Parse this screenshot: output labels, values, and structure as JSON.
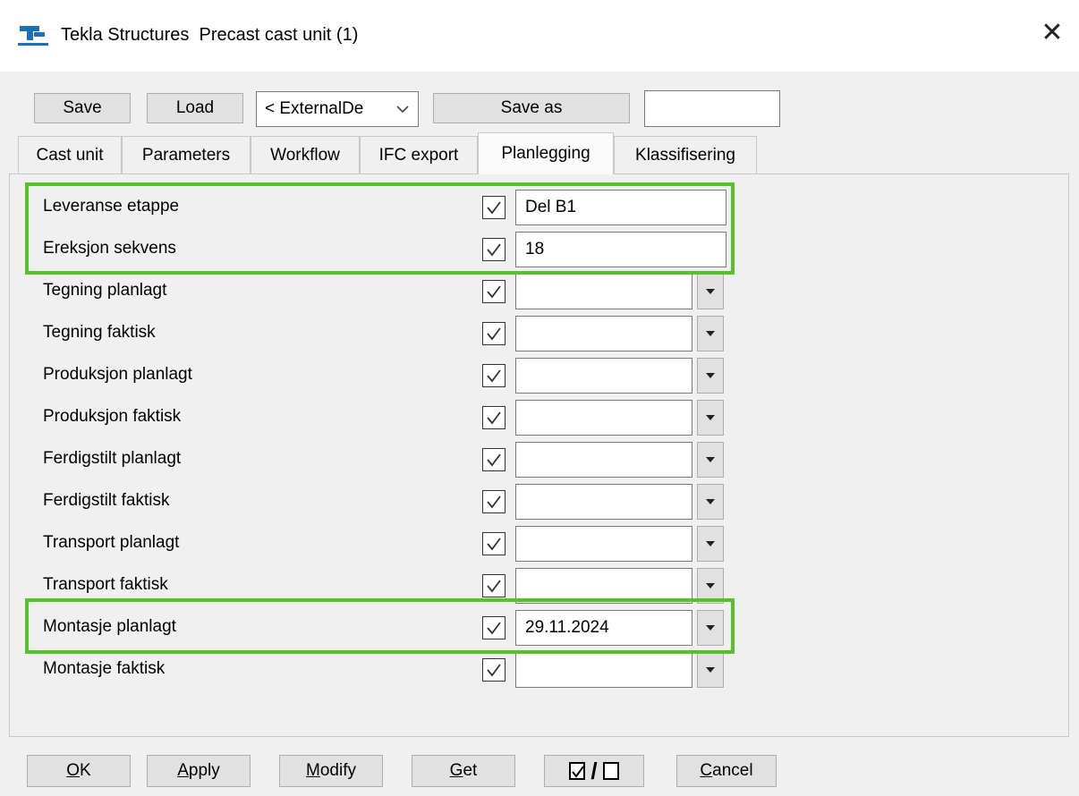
{
  "window": {
    "app_name": "Tekla Structures",
    "dialog_title": "Precast cast unit (1)",
    "close_glyph": "✕"
  },
  "toolbar": {
    "save_label": "Save",
    "load_label": "Load",
    "preset_value": "< ExternalDe",
    "save_as_label": "Save as",
    "save_as_name": ""
  },
  "tabs": [
    {
      "label": "Cast unit"
    },
    {
      "label": "Parameters"
    },
    {
      "label": "Workflow"
    },
    {
      "label": "IFC export"
    },
    {
      "label": "Planlegging",
      "active": true
    },
    {
      "label": "Klassifisering"
    }
  ],
  "rows": [
    {
      "label": "Leveranse etappe",
      "value": "Del B1",
      "checked": true,
      "has_dropdown": false
    },
    {
      "label": "Ereksjon sekvens",
      "value": "18",
      "checked": true,
      "has_dropdown": false
    },
    {
      "label": "Tegning planlagt",
      "value": "",
      "checked": true,
      "has_dropdown": true
    },
    {
      "label": "Tegning faktisk",
      "value": "",
      "checked": true,
      "has_dropdown": true
    },
    {
      "label": "Produksjon planlagt",
      "value": "",
      "checked": true,
      "has_dropdown": true
    },
    {
      "label": "Produksjon faktisk",
      "value": "",
      "checked": true,
      "has_dropdown": true
    },
    {
      "label": "Ferdigstilt planlagt",
      "value": "",
      "checked": true,
      "has_dropdown": true
    },
    {
      "label": "Ferdigstilt faktisk",
      "value": "",
      "checked": true,
      "has_dropdown": true
    },
    {
      "label": "Transport planlagt",
      "value": "",
      "checked": true,
      "has_dropdown": true
    },
    {
      "label": "Transport faktisk",
      "value": "",
      "checked": true,
      "has_dropdown": true
    },
    {
      "label": "Montasje planlagt",
      "value": "29.11.2024",
      "checked": true,
      "has_dropdown": true
    },
    {
      "label": "Montasje faktisk",
      "value": "",
      "checked": true,
      "has_dropdown": true
    }
  ],
  "buttons": {
    "ok": {
      "mnemonic": "O",
      "rest": "K"
    },
    "apply": {
      "mnemonic": "A",
      "rest": "pply"
    },
    "modify": {
      "mnemonic": "M",
      "rest": "odify"
    },
    "get": {
      "mnemonic": "G",
      "rest": "et"
    },
    "toggle_separator": "/",
    "cancel": {
      "mnemonic": "C",
      "rest": "ancel"
    }
  },
  "colors": {
    "highlight": "#56c12a",
    "logo_blue": "#1f6fb5"
  },
  "icons": {
    "app": "tekla-logo-icon",
    "close": "close-icon",
    "check": "checkmark-icon",
    "dropdown": "dropdown-arrow-icon"
  }
}
